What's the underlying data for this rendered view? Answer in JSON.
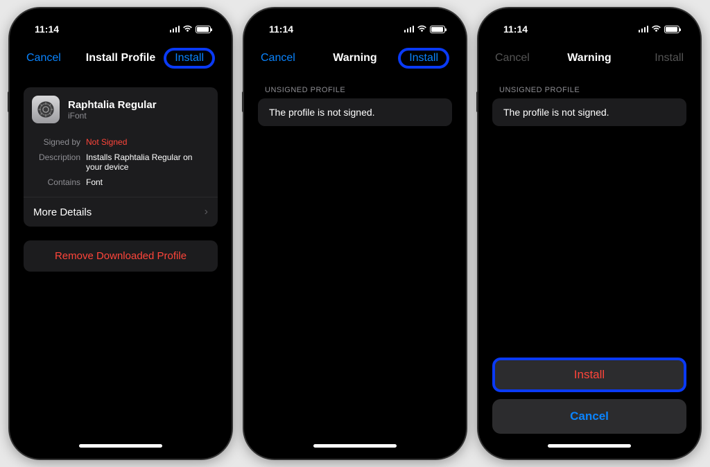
{
  "status": {
    "time": "11:14"
  },
  "screen1": {
    "nav": {
      "cancel": "Cancel",
      "title": "Install Profile",
      "install": "Install"
    },
    "profile": {
      "name": "Raphtalia Regular",
      "source": "iFont",
      "signed_by_label": "Signed by",
      "signed_by_value": "Not Signed",
      "description_label": "Description",
      "description_value": "Installs Raphtalia Regular on your device",
      "contains_label": "Contains",
      "contains_value": "Font",
      "more": "More Details"
    },
    "remove_action": "Remove Downloaded Profile"
  },
  "screen2": {
    "nav": {
      "cancel": "Cancel",
      "title": "Warning",
      "install": "Install"
    },
    "section_header": "UNSIGNED PROFILE",
    "warning_text": "The profile is not signed."
  },
  "screen3": {
    "nav": {
      "cancel": "Cancel",
      "title": "Warning",
      "install": "Install"
    },
    "section_header": "UNSIGNED PROFILE",
    "warning_text": "The profile is not signed.",
    "sheet": {
      "install": "Install",
      "cancel": "Cancel"
    }
  }
}
